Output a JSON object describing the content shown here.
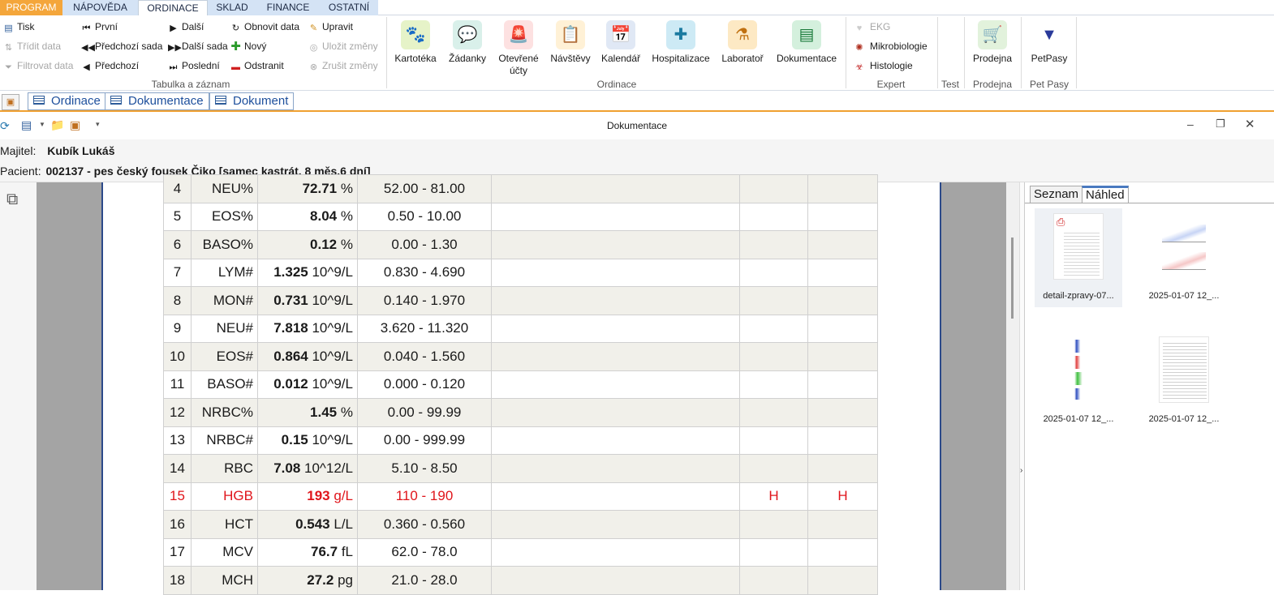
{
  "menu": {
    "tabs": [
      {
        "label": "PROGRAM"
      },
      {
        "label": "NÁPOVĚDA"
      },
      {
        "label": "ORDINACE"
      },
      {
        "label": "SKLAD"
      },
      {
        "label": "FINANCE"
      },
      {
        "label": "OSTATNÍ"
      }
    ]
  },
  "ribbon": {
    "table_group": {
      "label": "Tabulka a záznam",
      "print": "Tisk",
      "sort": "Třídit data",
      "filter": "Filtrovat data",
      "first": "První",
      "prev_set": "Předchozí sada",
      "prev": "Předchozí",
      "next": "Další",
      "next_set": "Další sada",
      "last": "Poslední",
      "refresh": "Obnovit data",
      "new": "Nový",
      "delete": "Odstranit",
      "edit": "Upravit",
      "save": "Uložit změny",
      "cancel": "Zrušit změny"
    },
    "ordinace_group": {
      "label": "Ordinace",
      "buttons": {
        "kartoteka": "Kartotéka",
        "zadanky": "Žádanky",
        "otevrene_1": "Otevřené",
        "otevrene_2": "účty",
        "navstevy": "Návštěvy",
        "kalendar": "Kalendář",
        "hospitalizace": "Hospitalizace",
        "laborator": "Laboratoř",
        "dokumentace": "Dokumentace"
      }
    },
    "expert_group": {
      "label": "Expert",
      "ekg": "EKG",
      "mikrobiologie": "Mikrobiologie",
      "histologie": "Histologie"
    },
    "test_group": {
      "label": "Test"
    },
    "prodejna_group": {
      "label": "Prodejna",
      "button": "Prodejna"
    },
    "petpasy_group": {
      "label": "Pet Pasy",
      "button": "PetPasy"
    }
  },
  "doc_tabs": [
    "Ordinace",
    "Dokumentace",
    "Dokument"
  ],
  "window": {
    "title": "Dokumentace"
  },
  "patient": {
    "owner_label": "Majitel:",
    "owner": "Kubík Lukáš",
    "patient_label": "Pacient:",
    "patient": "002137 - pes český fousek Čiko [samec kastrát, 8 měs.6 dní]"
  },
  "lab_table": [
    {
      "n": "4",
      "param": "NEU%",
      "value": "72.71",
      "unit": "%",
      "range": "52.00 - 81.00",
      "f1": "",
      "f2": ""
    },
    {
      "n": "5",
      "param": "EOS%",
      "value": "8.04",
      "unit": "%",
      "range": "0.50 - 10.00",
      "f1": "",
      "f2": ""
    },
    {
      "n": "6",
      "param": "BASO%",
      "value": "0.12",
      "unit": "%",
      "range": "0.00 - 1.30",
      "f1": "",
      "f2": ""
    },
    {
      "n": "7",
      "param": "LYM#",
      "value": "1.325",
      "unit": "10^9/L",
      "range": "0.830 - 4.690",
      "f1": "",
      "f2": ""
    },
    {
      "n": "8",
      "param": "MON#",
      "value": "0.731",
      "unit": "10^9/L",
      "range": "0.140 - 1.970",
      "f1": "",
      "f2": ""
    },
    {
      "n": "9",
      "param": "NEU#",
      "value": "7.818",
      "unit": "10^9/L",
      "range": "3.620 - 11.320",
      "f1": "",
      "f2": ""
    },
    {
      "n": "10",
      "param": "EOS#",
      "value": "0.864",
      "unit": "10^9/L",
      "range": "0.040 - 1.560",
      "f1": "",
      "f2": ""
    },
    {
      "n": "11",
      "param": "BASO#",
      "value": "0.012",
      "unit": "10^9/L",
      "range": "0.000 - 0.120",
      "f1": "",
      "f2": ""
    },
    {
      "n": "12",
      "param": "NRBC%",
      "value": "1.45",
      "unit": "%",
      "range": "0.00 - 99.99",
      "f1": "",
      "f2": ""
    },
    {
      "n": "13",
      "param": "NRBC#",
      "value": "0.15",
      "unit": "10^9/L",
      "range": "0.00 - 999.99",
      "f1": "",
      "f2": ""
    },
    {
      "n": "14",
      "param": "RBC",
      "value": "7.08",
      "unit": "10^12/L",
      "range": "5.10 - 8.50",
      "f1": "",
      "f2": ""
    },
    {
      "n": "15",
      "param": "HGB",
      "value": "193",
      "unit": "g/L",
      "range": "110 - 190",
      "f1": "H",
      "f2": "H",
      "highlight": true
    },
    {
      "n": "16",
      "param": "HCT",
      "value": "0.543",
      "unit": "L/L",
      "range": "0.360 - 0.560",
      "f1": "",
      "f2": ""
    },
    {
      "n": "17",
      "param": "MCV",
      "value": "76.7",
      "unit": "fL",
      "range": "62.0 - 78.0",
      "f1": "",
      "f2": ""
    },
    {
      "n": "18",
      "param": "MCH",
      "value": "27.2",
      "unit": "pg",
      "range": "21.0 - 28.0",
      "f1": "",
      "f2": ""
    }
  ],
  "right_panel": {
    "tabs": [
      "Seznam",
      "Náhled"
    ],
    "active_tab": "Náhled",
    "thumbs": [
      {
        "caption": "detail-zpravy-07..."
      },
      {
        "caption": "2025-01-07 12_..."
      },
      {
        "caption": "2025-01-07 12_..."
      },
      {
        "caption": "2025-01-07 12_..."
      }
    ]
  },
  "colors": {
    "accent_orange": "#f0a030",
    "highlight_red": "#e0151b",
    "tab_blue": "#1d4f9c"
  }
}
